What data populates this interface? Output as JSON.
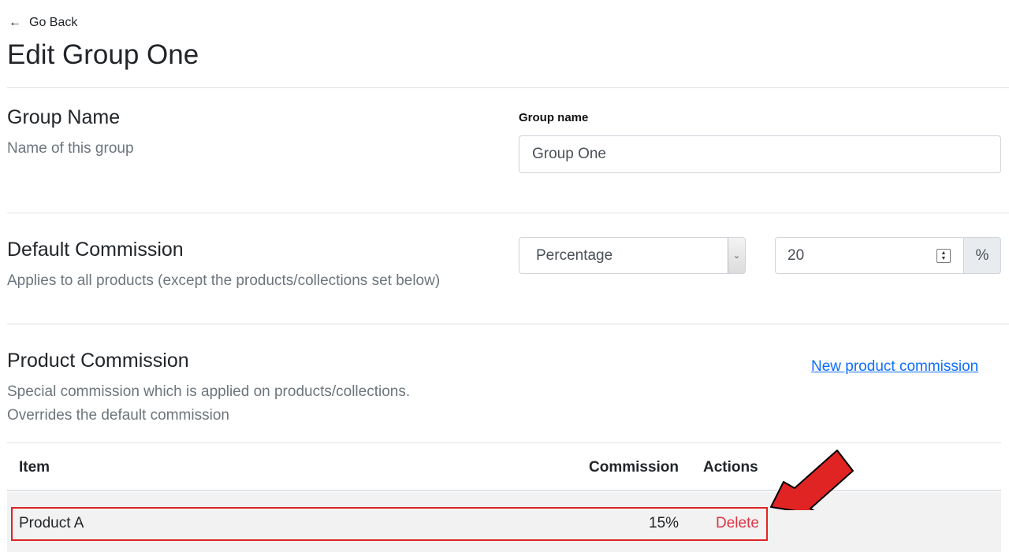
{
  "nav": {
    "back_label": "Go Back",
    "back_icon": "arrow-left-icon"
  },
  "page": {
    "title": "Edit Group One"
  },
  "group_name_section": {
    "title": "Group Name",
    "description": "Name of this group",
    "field_label": "Group name",
    "field_value": "Group One"
  },
  "default_commission_section": {
    "title": "Default Commission",
    "description": "Applies to all products (except the products/collections set below)",
    "type_selected": "Percentage",
    "value": "20",
    "unit": "%"
  },
  "product_commission_section": {
    "title": "Product Commission",
    "description_line1": "Special commission which is applied on products/collections.",
    "description_line2": "Overrides the default commission",
    "new_link": "New product commission"
  },
  "table": {
    "headers": {
      "item": "Item",
      "commission": "Commission",
      "actions": "Actions"
    },
    "rows": [
      {
        "item": "Product A",
        "commission": "15%",
        "action": "Delete"
      }
    ]
  },
  "colors": {
    "link": "#0d6efd",
    "danger": "#dc3545",
    "annotation": "#e02424"
  }
}
